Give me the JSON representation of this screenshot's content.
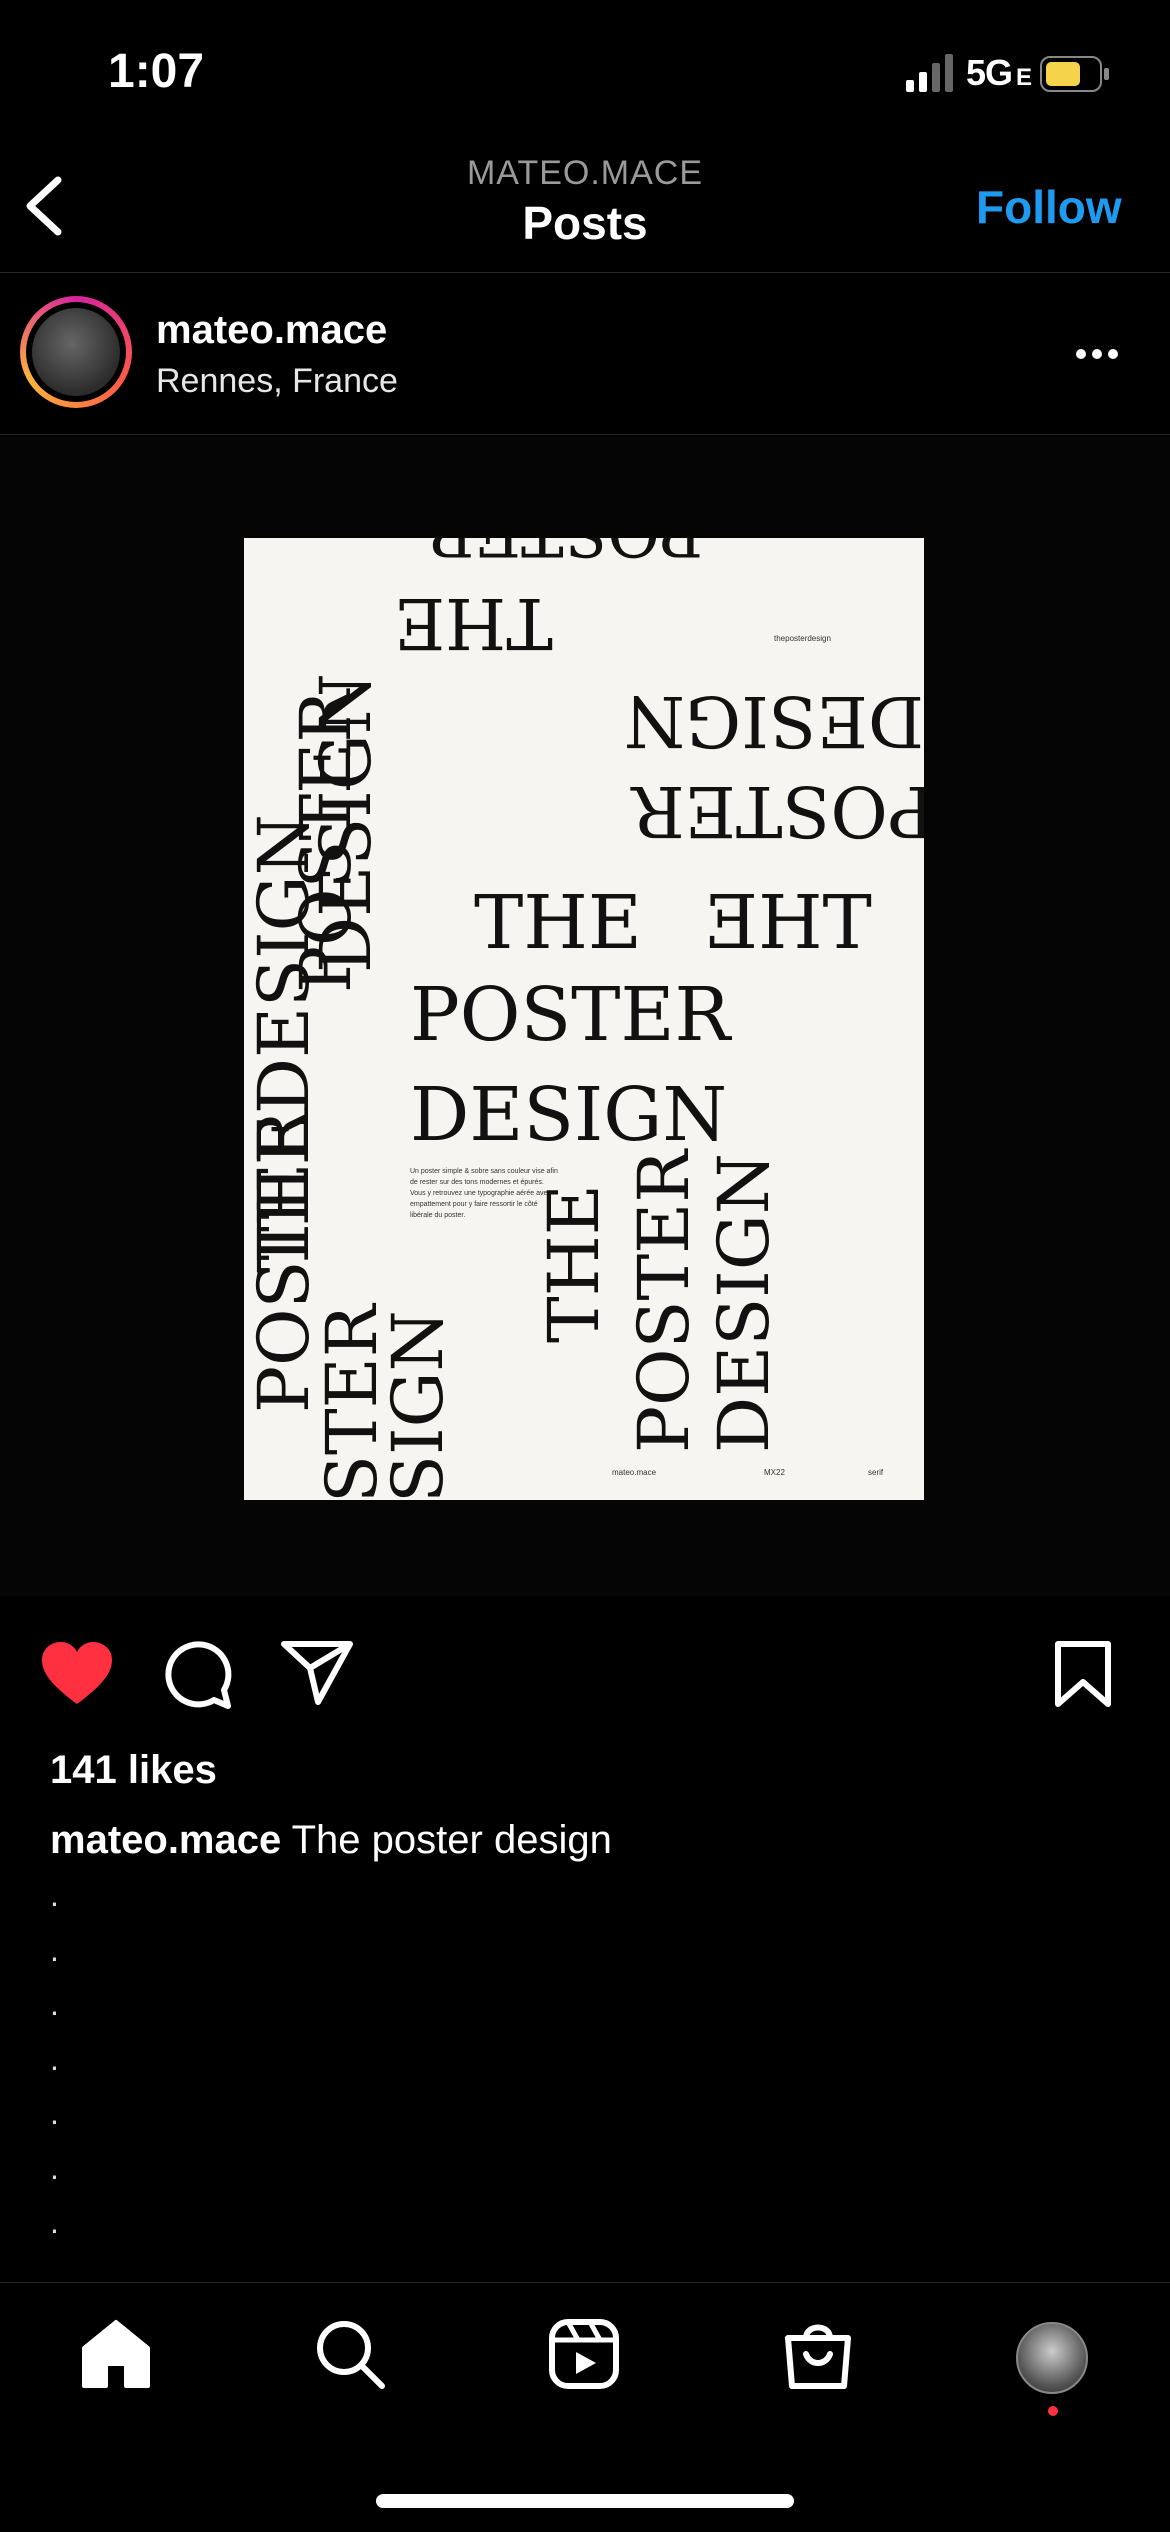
{
  "status": {
    "time": "1:07",
    "network": "5G",
    "network_suffix": "E"
  },
  "header": {
    "username": "MATEO.MACE",
    "title": "Posts",
    "follow_label": "Follow"
  },
  "author": {
    "name": "mateo.mace",
    "location": "Rennes, France"
  },
  "poster": {
    "words": {
      "the": "THE",
      "poster": "POSTER",
      "design": "DESIGN",
      "thedesign": "THEDESIGN",
      "ster": "STER",
      "sign": "SIGN"
    },
    "tag": "theposterdesign",
    "body": "Un poster simple & sobre sans couleur vise afin de rester sur des tons modernes et épurés. Vous y retrouvez une typographie aérée avec empattement pour y faire ressortir le côté libérale du poster.",
    "footer": [
      "mateo.mace",
      "MX22",
      "serif"
    ]
  },
  "post": {
    "likes": "141 likes",
    "caption_user": "mateo.mace",
    "caption_text": "The poster design",
    "dots": [
      ".",
      ".",
      ".",
      ".",
      ".",
      ".",
      "."
    ]
  },
  "icons": [
    "back-icon",
    "more-icon",
    "heart-icon",
    "comment-icon",
    "share-icon",
    "bookmark-icon",
    "home-icon",
    "search-icon",
    "reels-icon",
    "shop-icon"
  ],
  "colors": {
    "accent": "#1e9bf0",
    "like": "#ff3040"
  }
}
